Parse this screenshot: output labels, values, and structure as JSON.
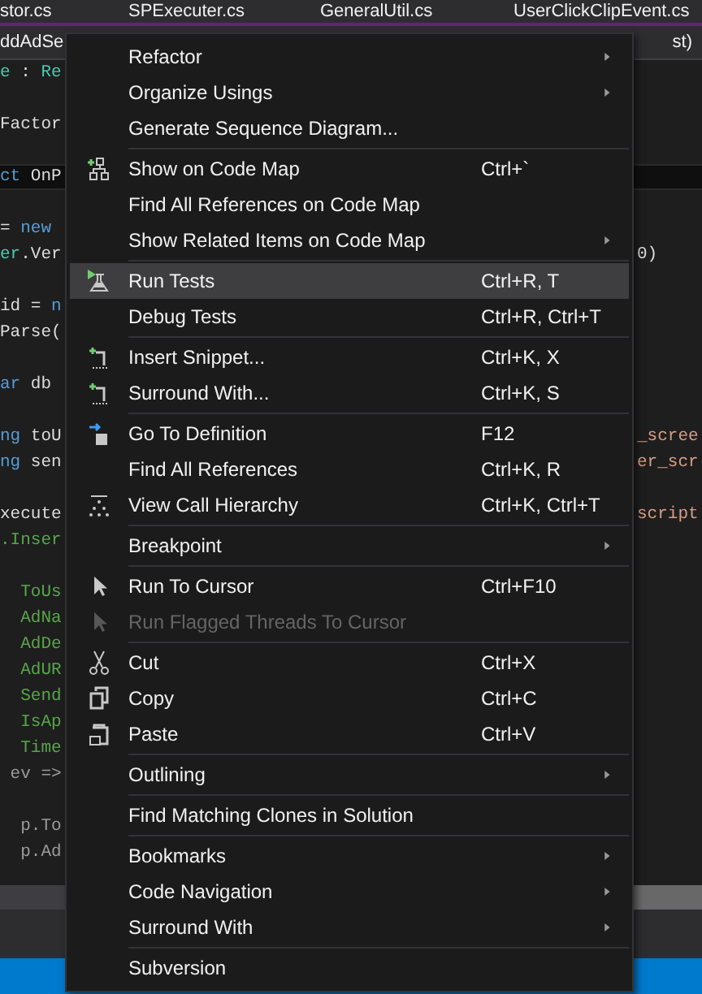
{
  "tabs": [
    {
      "label": "stor.cs"
    },
    {
      "label": "SPExecuter.cs"
    },
    {
      "label": "GeneralUtil.cs"
    },
    {
      "label": "UserClickClipEvent.cs"
    }
  ],
  "nav_bar": {
    "left": "ddAdSe",
    "right": "st)"
  },
  "code_lines": [
    {
      "kind": "code",
      "current": false,
      "left": [
        {
          "text": "e",
          "kind": "type"
        },
        {
          "text": " : ",
          "kind": "plain"
        },
        {
          "text": "Re",
          "kind": "type"
        }
      ]
    },
    {
      "kind": "blank"
    },
    {
      "kind": "code",
      "current": false,
      "left": [
        {
          "text": "Factor",
          "kind": "plain"
        }
      ]
    },
    {
      "kind": "blank"
    },
    {
      "kind": "code",
      "current": true,
      "left": [
        {
          "text": "ct",
          "kind": "keyword"
        },
        {
          "text": " OnP",
          "kind": "plain"
        }
      ]
    },
    {
      "kind": "blank"
    },
    {
      "kind": "code",
      "current": false,
      "left": [
        {
          "text": "= ",
          "kind": "plain"
        },
        {
          "text": "new",
          "kind": "keyword"
        }
      ]
    },
    {
      "kind": "code",
      "current": false,
      "left": [
        {
          "text": "er",
          "kind": "type"
        },
        {
          "text": ".Ver",
          "kind": "plain"
        }
      ],
      "right": [
        {
          "text": "0)",
          "kind": "plain"
        }
      ]
    },
    {
      "kind": "blank"
    },
    {
      "kind": "code",
      "current": false,
      "left": [
        {
          "text": "id = ",
          "kind": "plain"
        },
        {
          "text": "n",
          "kind": "keyword"
        }
      ]
    },
    {
      "kind": "code",
      "current": false,
      "left": [
        {
          "text": "Parse(",
          "kind": "plain"
        }
      ]
    },
    {
      "kind": "blank"
    },
    {
      "kind": "code",
      "current": false,
      "left": [
        {
          "text": "ar",
          "kind": "keyword"
        },
        {
          "text": " db",
          "kind": "plain"
        }
      ]
    },
    {
      "kind": "blank"
    },
    {
      "kind": "code",
      "current": false,
      "left": [
        {
          "text": "ng",
          "kind": "keyword"
        },
        {
          "text": " toU",
          "kind": "plain"
        }
      ],
      "right": [
        {
          "text": "_scree",
          "kind": "string"
        }
      ]
    },
    {
      "kind": "code",
      "current": false,
      "left": [
        {
          "text": "ng",
          "kind": "keyword"
        },
        {
          "text": " sen",
          "kind": "plain"
        }
      ],
      "right": [
        {
          "text": "er_scr",
          "kind": "string"
        }
      ]
    },
    {
      "kind": "blank"
    },
    {
      "kind": "code",
      "current": false,
      "left": [
        {
          "text": "xecute",
          "kind": "plain"
        }
      ],
      "right": [
        {
          "text": "script",
          "kind": "string"
        }
      ]
    },
    {
      "kind": "code",
      "current": false,
      "left": [
        {
          "text": ".Inser",
          "kind": "member"
        }
      ]
    },
    {
      "kind": "blank"
    },
    {
      "kind": "code",
      "current": false,
      "left": [
        {
          "text": "  ToUs",
          "kind": "member"
        }
      ]
    },
    {
      "kind": "code",
      "current": false,
      "left": [
        {
          "text": "  AdNa",
          "kind": "member"
        }
      ]
    },
    {
      "kind": "code",
      "current": false,
      "left": [
        {
          "text": "  AdDe",
          "kind": "member"
        }
      ]
    },
    {
      "kind": "code",
      "current": false,
      "left": [
        {
          "text": "  AdUR",
          "kind": "member"
        }
      ]
    },
    {
      "kind": "code",
      "current": false,
      "left": [
        {
          "text": "  Send",
          "kind": "member"
        }
      ]
    },
    {
      "kind": "code",
      "current": false,
      "left": [
        {
          "text": "  IsAp",
          "kind": "member"
        }
      ]
    },
    {
      "kind": "code",
      "current": false,
      "left": [
        {
          "text": "  Time",
          "kind": "member"
        }
      ]
    },
    {
      "kind": "code",
      "current": false,
      "left": [
        {
          "text": " ev =>",
          "kind": "dim"
        }
      ]
    },
    {
      "kind": "blank"
    },
    {
      "kind": "code",
      "current": false,
      "left": [
        {
          "text": "  p.To",
          "kind": "dim"
        }
      ]
    },
    {
      "kind": "code",
      "current": false,
      "left": [
        {
          "text": "  p.Ad",
          "kind": "dim"
        }
      ]
    }
  ],
  "context_menu": {
    "groups": [
      [
        {
          "label": "Refactor",
          "submenu": true,
          "selected": false,
          "disabled": false
        },
        {
          "label": "Organize Usings",
          "submenu": true,
          "selected": false,
          "disabled": false
        },
        {
          "label": "Generate Sequence Diagram...",
          "submenu": false,
          "selected": false,
          "disabled": false
        }
      ],
      [
        {
          "label": "Show on Code Map",
          "shortcut": "Ctrl+`",
          "submenu": false,
          "selected": false,
          "disabled": false
        },
        {
          "label": "Find All References on Code Map",
          "submenu": false,
          "selected": false,
          "disabled": false
        },
        {
          "label": "Show Related Items on Code Map",
          "submenu": true,
          "selected": false,
          "disabled": false
        }
      ],
      [
        {
          "label": "Run Tests",
          "shortcut": "Ctrl+R, T",
          "submenu": false,
          "selected": true,
          "disabled": false
        },
        {
          "label": "Debug Tests",
          "shortcut": "Ctrl+R, Ctrl+T",
          "submenu": false,
          "selected": false,
          "disabled": false
        }
      ],
      [
        {
          "label": "Insert Snippet...",
          "shortcut": "Ctrl+K, X",
          "submenu": false,
          "selected": false,
          "disabled": false
        },
        {
          "label": "Surround With...",
          "shortcut": "Ctrl+K, S",
          "submenu": false,
          "selected": false,
          "disabled": false
        }
      ],
      [
        {
          "label": "Go To Definition",
          "shortcut": "F12",
          "submenu": false,
          "selected": false,
          "disabled": false
        },
        {
          "label": "Find All References",
          "shortcut": "Ctrl+K, R",
          "submenu": false,
          "selected": false,
          "disabled": false
        },
        {
          "label": "View Call Hierarchy",
          "shortcut": "Ctrl+K, Ctrl+T",
          "submenu": false,
          "selected": false,
          "disabled": false
        }
      ],
      [
        {
          "label": "Breakpoint",
          "submenu": true,
          "selected": false,
          "disabled": false
        }
      ],
      [
        {
          "label": "Run To Cursor",
          "shortcut": "Ctrl+F10",
          "submenu": false,
          "selected": false,
          "disabled": false
        },
        {
          "label": "Run Flagged Threads To Cursor",
          "submenu": false,
          "selected": false,
          "disabled": true
        }
      ],
      [
        {
          "label": "Cut",
          "shortcut": "Ctrl+X",
          "submenu": false,
          "selected": false,
          "disabled": false
        },
        {
          "label": "Copy",
          "shortcut": "Ctrl+C",
          "submenu": false,
          "selected": false,
          "disabled": false
        },
        {
          "label": "Paste",
          "shortcut": "Ctrl+V",
          "submenu": false,
          "selected": false,
          "disabled": false
        }
      ],
      [
        {
          "label": "Outlining",
          "submenu": true,
          "selected": false,
          "disabled": false
        }
      ],
      [
        {
          "label": "Find Matching Clones in Solution",
          "submenu": false,
          "selected": false,
          "disabled": false
        }
      ],
      [
        {
          "label": "Bookmarks",
          "submenu": true,
          "selected": false,
          "disabled": false
        },
        {
          "label": "Code Navigation",
          "submenu": true,
          "selected": false,
          "disabled": false
        },
        {
          "label": "Surround With",
          "submenu": true,
          "selected": false,
          "disabled": false
        }
      ],
      [
        {
          "label": "Subversion",
          "submenu": false,
          "selected": false,
          "disabled": false
        }
      ]
    ]
  }
}
